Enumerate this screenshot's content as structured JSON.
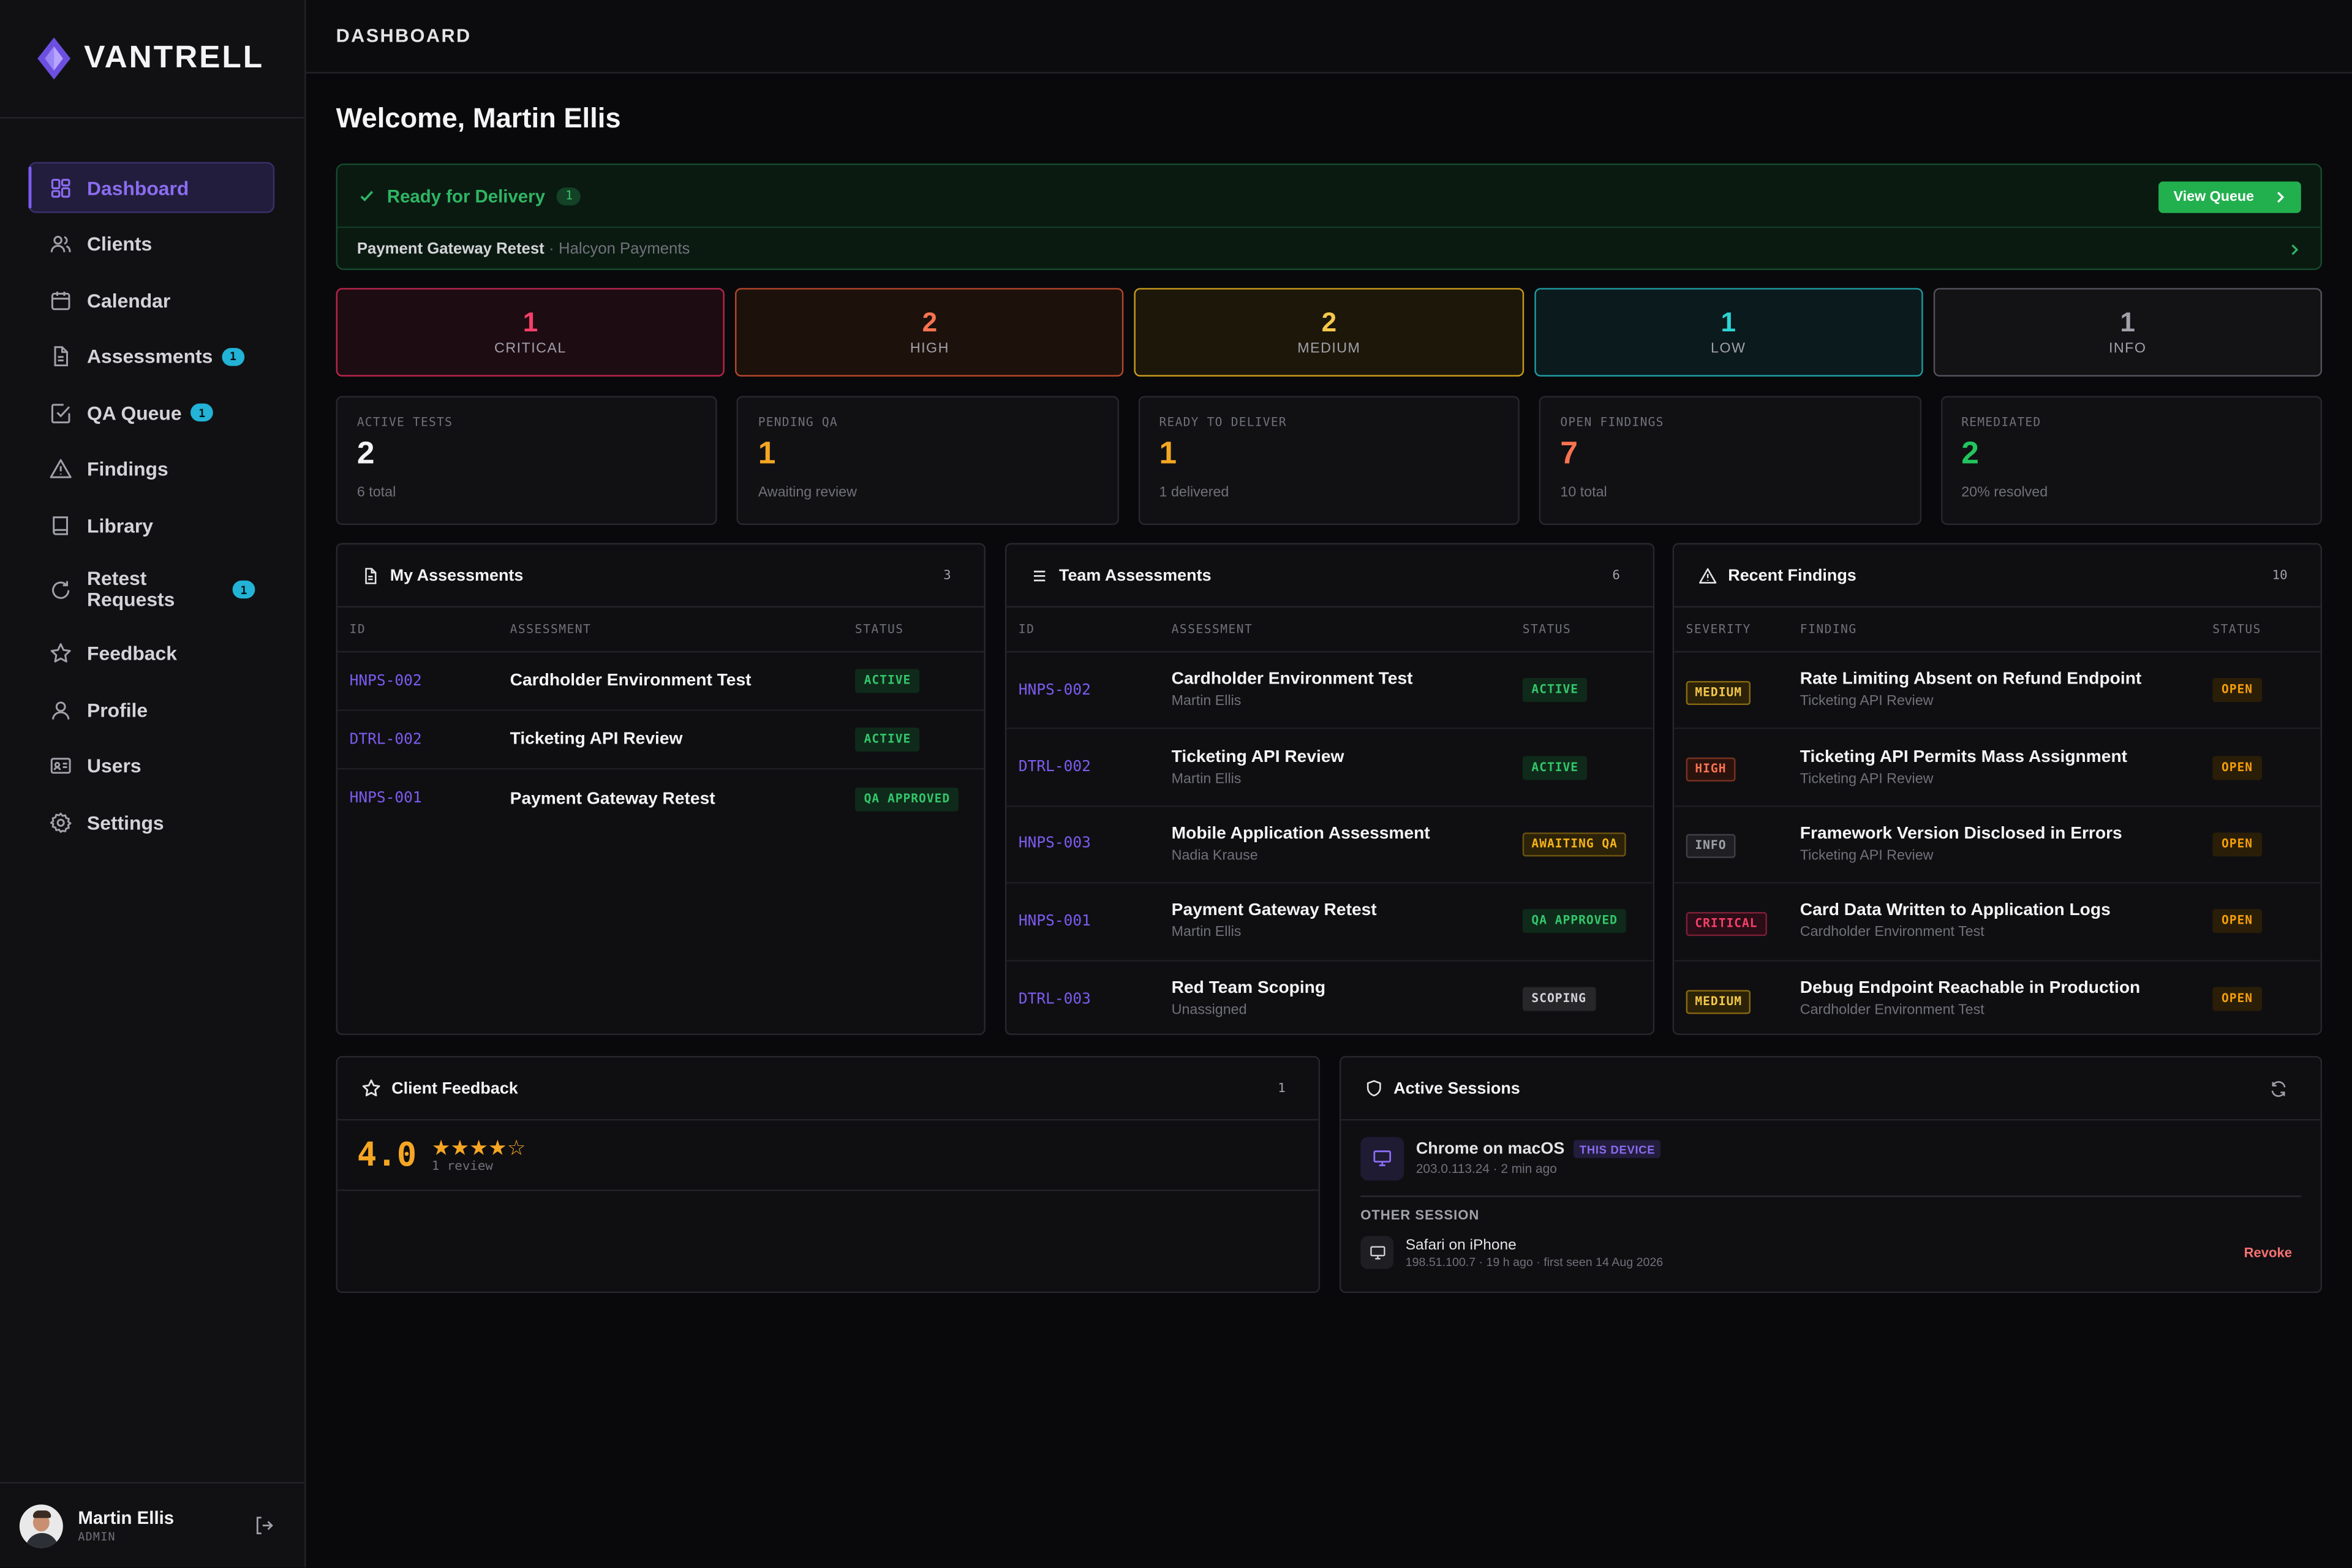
{
  "brand": {
    "name": "VANTRELL"
  },
  "colors": {
    "accent": "#7c5cf0",
    "success": "#22b04f",
    "critical": "#f43f6a",
    "high": "#f97351",
    "medium": "#f5c84a",
    "low": "#2dd4d4",
    "info": "#a1a1aa"
  },
  "sidebar": {
    "items": [
      {
        "label": "Dashboard",
        "icon": "grid-icon"
      },
      {
        "label": "Clients",
        "icon": "users-icon"
      },
      {
        "label": "Calendar",
        "icon": "calendar-icon"
      },
      {
        "label": "Assessments",
        "icon": "file-icon",
        "badge": "1"
      },
      {
        "label": "QA Queue",
        "icon": "check-square-icon",
        "badge": "1"
      },
      {
        "label": "Findings",
        "icon": "warning-icon"
      },
      {
        "label": "Library",
        "icon": "book-icon"
      },
      {
        "label": "Retest Requests",
        "label_line1": "Retest",
        "label_line2": "Requests",
        "icon": "refresh-icon",
        "badge": "1"
      },
      {
        "label": "Feedback",
        "icon": "star-icon"
      },
      {
        "label": "Profile",
        "icon": "user-icon"
      },
      {
        "label": "Users",
        "icon": "id-card-icon"
      },
      {
        "label": "Settings",
        "icon": "gear-icon"
      }
    ],
    "user": {
      "name": "Martin Ellis",
      "role": "ADMIN"
    }
  },
  "header": {
    "title": "DASHBOARD"
  },
  "welcome": "Welcome, Martin Ellis",
  "ready": {
    "title": "Ready for Delivery",
    "count": "1",
    "button": "View Queue",
    "item_title": "Payment Gateway Retest",
    "item_sep": "·",
    "item_client": "Halcyon Payments"
  },
  "severity": [
    {
      "count": "1",
      "label": "CRITICAL",
      "color": "#f43f6a"
    },
    {
      "count": "2",
      "label": "HIGH",
      "color": "#f97351"
    },
    {
      "count": "2",
      "label": "MEDIUM",
      "color": "#f5c84a"
    },
    {
      "count": "1",
      "label": "LOW",
      "color": "#2dd4d4"
    },
    {
      "count": "1",
      "label": "INFO",
      "color": "#a1a1aa"
    }
  ],
  "stats": [
    {
      "label": "ACTIVE TESTS",
      "value": "2",
      "sub": "6 total",
      "color": "#f4f4f5"
    },
    {
      "label": "PENDING QA",
      "value": "1",
      "sub": "Awaiting review",
      "color": "#f5a623"
    },
    {
      "label": "READY TO DELIVER",
      "value": "1",
      "sub": "1 delivered",
      "color": "#f5a623"
    },
    {
      "label": "OPEN FINDINGS",
      "value": "7",
      "sub": "10 total",
      "color": "#f97351"
    },
    {
      "label": "REMEDIATED",
      "value": "2",
      "sub": "20% resolved",
      "color": "#22c55e"
    }
  ],
  "my_assessments": {
    "title": "My Assessments",
    "count": "3",
    "columns": [
      "ID",
      "ASSESSMENT",
      "STATUS"
    ],
    "rows": [
      {
        "id": "HNPS-002",
        "name": "Cardholder Environment Test",
        "status": "ACTIVE"
      },
      {
        "id": "DTRL-002",
        "name": "Ticketing API Review",
        "status": "ACTIVE"
      },
      {
        "id": "HNPS-001",
        "name": "Payment Gateway Retest",
        "status": "QA APPROVED"
      }
    ]
  },
  "team_assessments": {
    "title": "Team Assessments",
    "count": "6",
    "columns": [
      "ID",
      "ASSESSMENT",
      "STATUS"
    ],
    "rows": [
      {
        "id": "HNPS-002",
        "name": "Cardholder Environment Test",
        "owner": "Martin Ellis",
        "status": "ACTIVE"
      },
      {
        "id": "DTRL-002",
        "name": "Ticketing API Review",
        "owner": "Martin Ellis",
        "status": "ACTIVE"
      },
      {
        "id": "HNPS-003",
        "name": "Mobile Application Assessment",
        "owner": "Nadia Krause",
        "status": "AWAITING QA"
      },
      {
        "id": "HNPS-001",
        "name": "Payment Gateway Retest",
        "owner": "Martin Ellis",
        "status": "QA APPROVED"
      },
      {
        "id": "DTRL-003",
        "name": "Red Team Scoping",
        "owner": "Unassigned",
        "status": "SCOPING"
      }
    ]
  },
  "recent_findings": {
    "title": "Recent Findings",
    "count": "10",
    "columns": [
      "SEVERITY",
      "FINDING",
      "STATUS"
    ],
    "rows": [
      {
        "severity": "MEDIUM",
        "title": "Rate Limiting Absent on Refund Endpoint",
        "assessment": "Ticketing API Review",
        "status": "OPEN"
      },
      {
        "severity": "HIGH",
        "title": "Ticketing API Permits Mass Assignment",
        "assessment": "Ticketing API Review",
        "status": "OPEN"
      },
      {
        "severity": "INFO",
        "title": "Framework Version Disclosed in Errors",
        "assessment": "Ticketing API Review",
        "status": "OPEN"
      },
      {
        "severity": "CRITICAL",
        "title": "Card Data Written to Application Logs",
        "assessment": "Cardholder Environment Test",
        "status": "OPEN"
      },
      {
        "severity": "MEDIUM",
        "title": "Debug Endpoint Reachable in Production",
        "assessment": "Cardholder Environment Test",
        "status": "OPEN"
      }
    ]
  },
  "client_feedback": {
    "title": "Client Feedback",
    "count": "1",
    "score": "4.0",
    "rating": 4,
    "max_rating": 5,
    "reviews": "1 review"
  },
  "active_sessions": {
    "title": "Active Sessions",
    "current": {
      "name": "Chrome on macOS",
      "tag": "THIS DEVICE",
      "detail": "203.0.113.24 · 2 min ago"
    },
    "other_label": "OTHER SESSION",
    "other": {
      "name": "Safari on iPhone",
      "detail": "198.51.100.7 · 19 h ago · first seen 14 Aug 2026",
      "action": "Revoke"
    }
  }
}
